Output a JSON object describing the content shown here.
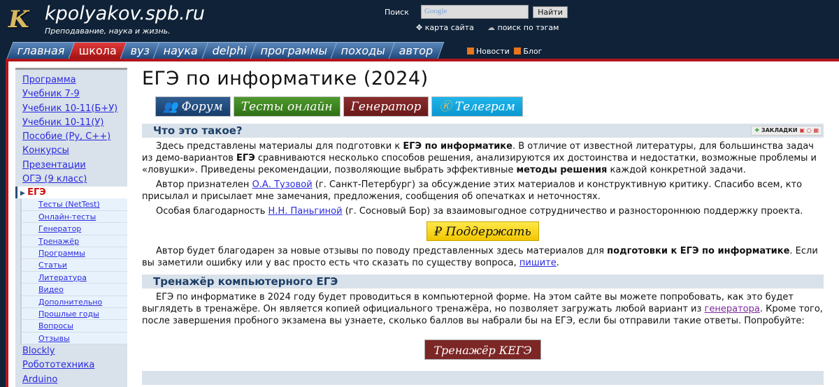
{
  "header": {
    "logo": "K",
    "site": "kpolyakov.spb.ru",
    "tagline": "Преподавание, наука и жизнь.",
    "search_label": "Поиск",
    "search_placeholder": "Google",
    "search_button": "Найти",
    "sitemap": "карта сайта",
    "tag_search": "поиск по тэгам"
  },
  "tabs": [
    "главная",
    "школа",
    "вуз",
    "наука",
    "delphi",
    "программы",
    "походы",
    "автор"
  ],
  "news": "Новости",
  "blog": "Блог",
  "sidebar": {
    "top": [
      "Программа",
      "Учебник 7-9",
      "Учебник 10-11(Б+У)",
      "Учебник 10-11(У)",
      "Пособие (Py, C++)",
      "Конкурсы",
      "Презентации",
      "ОГЭ (9 класс)"
    ],
    "current": "ЕГЭ",
    "sub": [
      "Тесты (NetTest)",
      "Онлайн-тесты",
      "Генератор",
      "Тренажёр",
      "Программы",
      "Статьи",
      "Литература",
      "Видео",
      "Дополнительно",
      "Прошлые годы",
      "Вопросы",
      "Отзывы"
    ],
    "bottom": [
      "Blockly",
      "Робототехника",
      "Arduino"
    ]
  },
  "main": {
    "title": "ЕГЭ по информатике (2024)",
    "buttons": {
      "forum": "Форум",
      "tests": "Тесты онлайн",
      "generator": "Генератор",
      "telegram": "Телеграм"
    },
    "sec1": {
      "title": "Что это такое?",
      "bookmarks": "ЗАКЛАДКИ",
      "p1": [
        "Здесь представлены материалы для подготовки к ",
        "ЕГЭ по информатике",
        ". В отличие от известной литературы, для большинства задач из демо-вариантов ",
        "ЕГЭ",
        " сравниваются несколько способов решения, анализируются их достоинства и недостатки, возможные проблемы и «ловушки». Приведены рекомендации, позволяющие выбрать эффективные ",
        "методы решения",
        " каждой конкретной задачи."
      ],
      "p2": [
        "Автор признателен ",
        "О.А. Тузовой",
        " (г. Санкт-Петербург) за обсуждение этих материалов и конструктивную критику. Спасибо всем, кто присылал и присылает мне замечания, предложения, сообщения об опечатках и неточностях."
      ],
      "p3": [
        "Особая благодарность ",
        "Н.Н. Паньгиной",
        " (г. Сосновый Бор) за взаимовыгодное сотрудничество и разностороннюю поддержку проекта."
      ],
      "support": "₽ Поддержать",
      "p4": [
        "Автор будет благодарен за новые отзывы по поводу представленных здесь материалов для ",
        "подготовки к ЕГЭ по информатике",
        ". Если вы заметили ошибку или у вас просто есть что сказать по существу вопроса, ",
        "пишите",
        "."
      ]
    },
    "sec2": {
      "title": "Тренажёр компьютерного ЕГЭ",
      "p1": [
        "ЕГЭ по информатике в 2024 году будет проводиться в компьютерной форме. На этом сайте вы можете попробовать, как это будет выглядеть в тренажёре. Он является копией официального тренажёра, но позволяет загружать любой вариант из ",
        "генератора",
        ". Кроме того, после завершения пробного экзамена вы узнаете, сколько баллов вы набрали бы на ЕГЭ, если бы отправили такие ответы. Попробуйте:"
      ],
      "button": "Тренажёр КЕГЭ"
    }
  }
}
